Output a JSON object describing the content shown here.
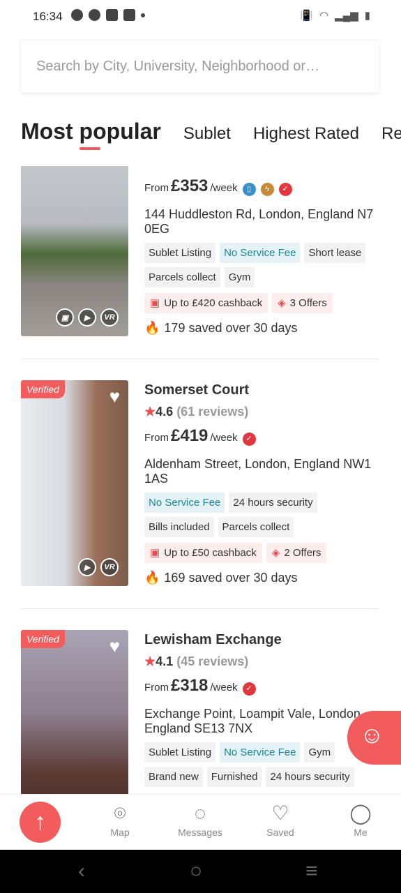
{
  "status_bar": {
    "time": "16:34"
  },
  "search": {
    "placeholder": "Search by City, University, Neighborhood or…"
  },
  "tabs": [
    {
      "label": "Most popular",
      "active": true
    },
    {
      "label": "Sublet"
    },
    {
      "label": "Highest Rated"
    },
    {
      "label": "Rec"
    }
  ],
  "listings": [
    {
      "title": "",
      "rating": "",
      "reviews": "",
      "verified": false,
      "price_prefix": "From",
      "price": "£353",
      "price_unit": "/week",
      "badges": [
        "door-icon",
        "bolt-icon",
        "shield-icon"
      ],
      "address": "144 Huddleston Rd, London, England N7 0EG",
      "chips": [
        {
          "label": "Sublet Listing"
        },
        {
          "label": "No Service Fee",
          "teal": true
        },
        {
          "label": "Short lease"
        },
        {
          "label": "Parcels collect"
        },
        {
          "label": "Gym"
        }
      ],
      "cashback": "Up to £420 cashback",
      "offers": "3 Offers",
      "saved": "179 saved over 30 days",
      "media": [
        "photo",
        "video",
        "VR"
      ]
    },
    {
      "title": "Somerset Court",
      "rating": "4.6",
      "reviews": "(61 reviews)",
      "verified": true,
      "verified_label": "Verified",
      "price_prefix": "From",
      "price": "£419",
      "price_unit": "/week",
      "badges": [
        "shield-icon"
      ],
      "address": "Aldenham Street, London, England NW1 1AS",
      "chips": [
        {
          "label": "No Service Fee",
          "teal": true
        },
        {
          "label": "24 hours security"
        },
        {
          "label": "Bills included"
        },
        {
          "label": "Parcels collect"
        }
      ],
      "cashback": "Up to £50 cashback",
      "offers": "2 Offers",
      "saved": "169 saved over 30 days",
      "media": [
        "video",
        "VR"
      ]
    },
    {
      "title": "Lewisham Exchange",
      "rating": "4.1",
      "reviews": "(45 reviews)",
      "verified": true,
      "verified_label": "Verified",
      "price_prefix": "From",
      "price": "£318",
      "price_unit": "/week",
      "badges": [
        "shield-icon"
      ],
      "address": "Exchange Point, Loampit Vale, London, England SE13 7NX",
      "chips": [
        {
          "label": "Sublet Listing"
        },
        {
          "label": "No Service Fee",
          "teal": true
        },
        {
          "label": "Gym"
        },
        {
          "label": "Brand new"
        },
        {
          "label": "Furnished"
        },
        {
          "label": "24 hours security"
        }
      ],
      "media": []
    }
  ],
  "bottom_nav": [
    {
      "label": "Map",
      "icon": "map-pin-icon"
    },
    {
      "label": "Messages",
      "icon": "chat-icon"
    },
    {
      "label": "Saved",
      "icon": "heart-icon"
    },
    {
      "label": "Me",
      "icon": "user-icon"
    }
  ],
  "colors": {
    "accent": "#f25c5c",
    "teal": "#1b8796"
  }
}
